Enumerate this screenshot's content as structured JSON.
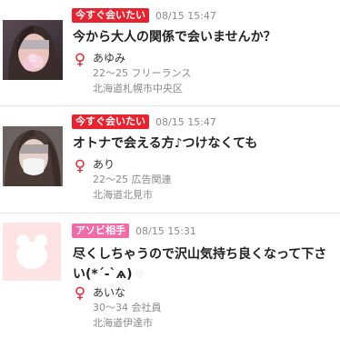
{
  "posts": [
    {
      "badge": "今すぐ会いたい",
      "time": "08/15 15:47",
      "title": "今から大人の関係で会いませんか？",
      "gender_symbol": "♀",
      "name": "あゆみ",
      "profile": "22〜25 フリーランス",
      "location": "北海道札幌市中央区"
    },
    {
      "badge": "今すぐ会いたい",
      "time": "08/15 15:47",
      "title": "オトナで会える方♪つけなくても",
      "gender_symbol": "♀",
      "name": "あり",
      "profile": "22〜25 広告関連",
      "location": "北海道北見市"
    },
    {
      "badge": "アソビ相手",
      "time": "08/15 15:31",
      "title": "尽くしちゃうので沢山気持ち良くなって下さい(*´‐`ѧ)",
      "heart": "♡",
      "gender_symbol": "♀",
      "name": "あいな",
      "profile": "30〜34 会社員",
      "location": "北海道伊達市"
    }
  ],
  "colors": {
    "badge_now": "#e8232f",
    "badge_play": "#f26aa7",
    "gender": "#e8232f",
    "placeholder_bg": "#fde3e3"
  }
}
